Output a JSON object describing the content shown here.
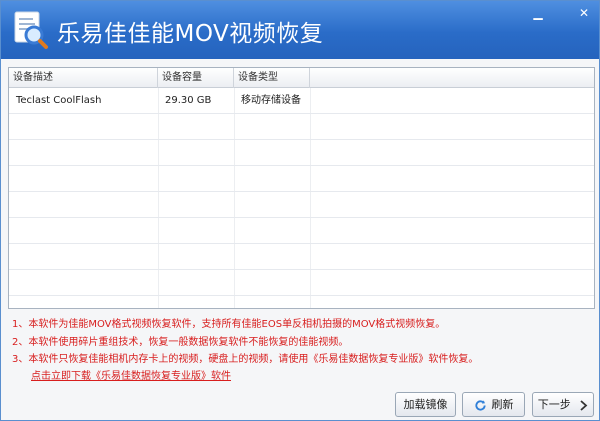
{
  "window": {
    "title": "乐易佳佳能MOV视频恢复",
    "minimize_glyph": "▁",
    "close_glyph": "✕"
  },
  "device_table": {
    "headers": [
      "设备描述",
      "设备容量",
      "设备类型"
    ],
    "rows": [
      {
        "description": "Teclast CoolFlash",
        "capacity": "29.30 GB",
        "type": "移动存储设备"
      }
    ]
  },
  "notes": {
    "line1": "1、本软件为佳能MOV格式视频恢复软件，支持所有佳能EOS单反相机拍摄的MOV格式视频恢复。",
    "line2": "2、本软件使用碎片重组技术，恢复一般数据恢复软件不能恢复的佳能视频。",
    "line3": "3、本软件只恢复佳能相机内存卡上的视频，硬盘上的视频，请使用《乐易佳数据恢复专业版》软件恢复。",
    "download_link": "点击立即下载《乐易佳数据恢复专业版》软件"
  },
  "buttons": {
    "load_image": "加载镜像",
    "refresh": "刷新",
    "next": "下一步"
  },
  "colors": {
    "titlebar": "#2a6cc8",
    "note_red": "#d81e1e",
    "refresh_icon": "#2f7fd8"
  },
  "icons": {
    "app": "magnifier-document-icon",
    "refresh": "refresh-icon",
    "next": "chevron-right-icon"
  }
}
